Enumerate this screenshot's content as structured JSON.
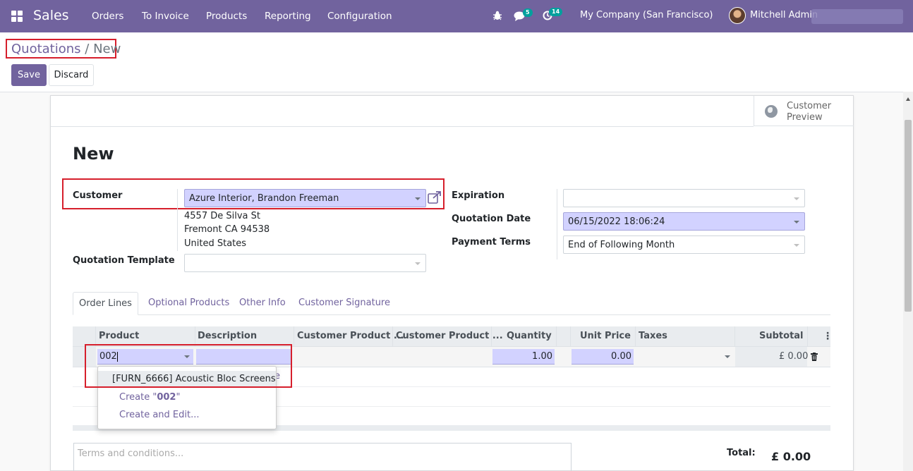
{
  "navbar": {
    "app_name": "Sales",
    "menu": [
      "Orders",
      "To Invoice",
      "Products",
      "Reporting",
      "Configuration"
    ],
    "messages_count": "5",
    "activities_count": "14",
    "company": "My Company (San Francisco)",
    "user": "Mitchell Admin",
    "color": "#71639e"
  },
  "breadcrumb": {
    "parent": "Quotations",
    "separator": "/",
    "current": "New"
  },
  "buttons": {
    "save": "Save",
    "discard": "Discard"
  },
  "smart_button": {
    "label": "Customer Preview",
    "icon": "globe-icon"
  },
  "form": {
    "title": "New",
    "customer": {
      "label": "Customer",
      "value": "Azure Interior, Brandon Freeman",
      "address_line1": "4557 De Silva St",
      "address_line2": "Fremont CA 94538",
      "address_line3": "United States"
    },
    "quotation_template": {
      "label": "Quotation Template",
      "value": ""
    },
    "expiration": {
      "label": "Expiration",
      "value": ""
    },
    "quotation_date": {
      "label": "Quotation Date",
      "value": "06/15/2022 18:06:24"
    },
    "payment_terms": {
      "label": "Payment Terms",
      "value": "End of Following Month"
    }
  },
  "tabs": [
    "Order Lines",
    "Optional Products",
    "Other Info",
    "Customer Signature"
  ],
  "order_lines": {
    "columns": [
      "Product",
      "Description",
      "Customer Product ...",
      "Customer Product ...",
      "Quantity",
      "Unit Price",
      "Taxes",
      "Subtotal"
    ],
    "editing_row": {
      "product": "002",
      "description": "",
      "quantity": "1.00",
      "unit_price": "0.00",
      "taxes": "",
      "subtotal": "£ 0.00"
    },
    "partial_link_text": "e"
  },
  "autocomplete": {
    "items": [
      "[FURN_6666] Acoustic Bloc Screens"
    ],
    "create_prefix": "Create \"",
    "create_query": "002",
    "create_suffix": "\"",
    "create_and_edit": "Create and Edit..."
  },
  "terms_placeholder": "Terms and conditions...",
  "totals": {
    "label": "Total:",
    "value": "£ 0.00"
  }
}
